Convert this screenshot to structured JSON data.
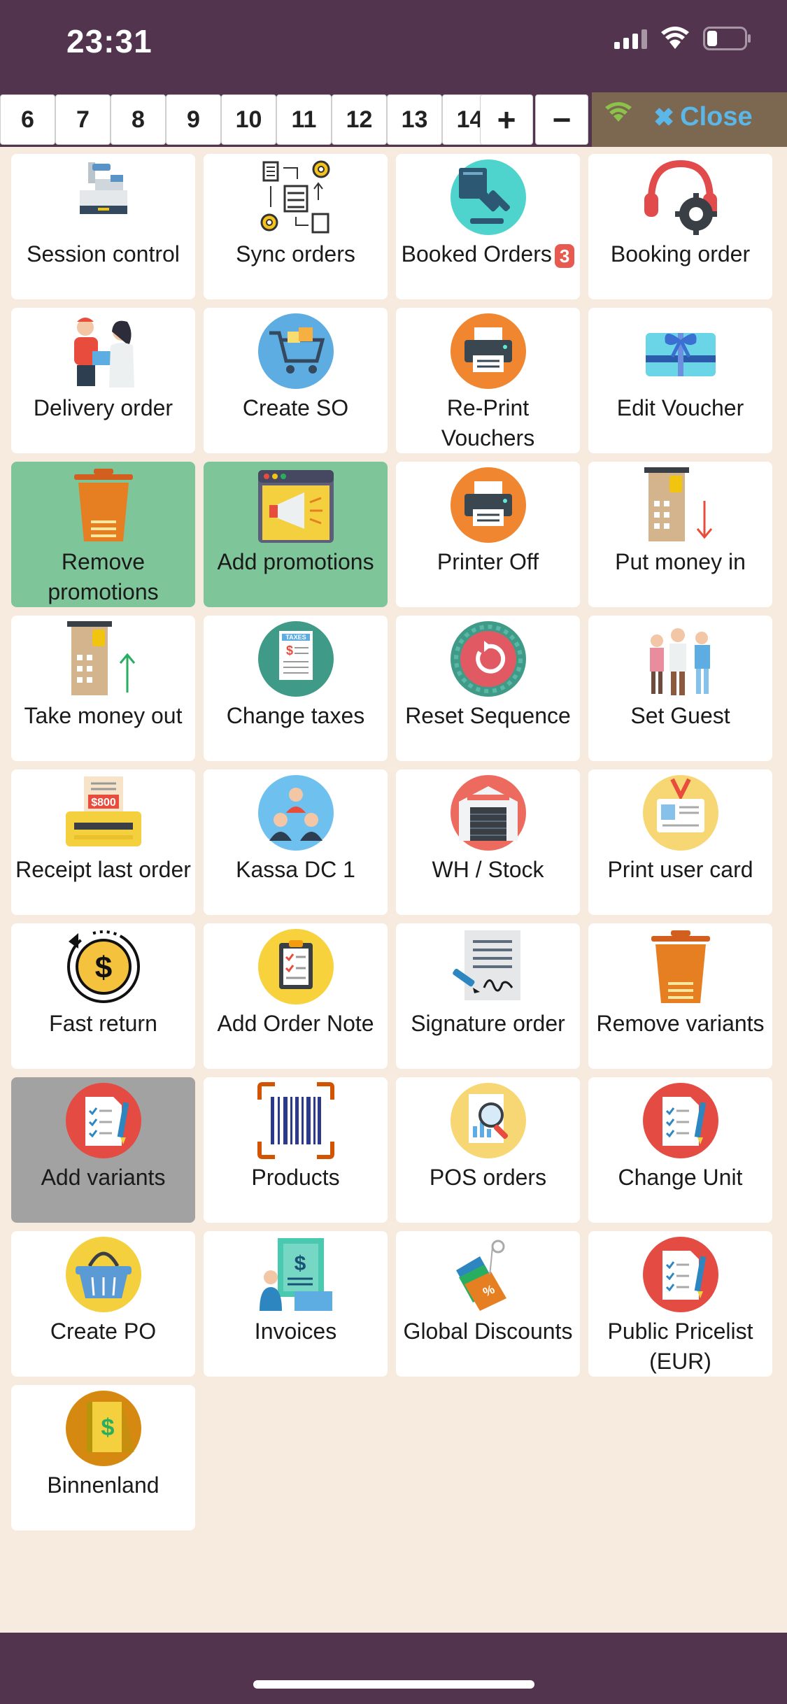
{
  "status": {
    "time": "23:31"
  },
  "toolbar": {
    "numbers": [
      "6",
      "7",
      "8",
      "9",
      "10",
      "11",
      "12",
      "13",
      "14"
    ],
    "plus": "+",
    "minus": "−",
    "close_label": "Close"
  },
  "tiles": [
    {
      "label": "Session control",
      "icon": "cash-register-icon"
    },
    {
      "label": "Sync orders",
      "icon": "sync-workflow-icon"
    },
    {
      "label": "Booked Orders",
      "badge": "3",
      "icon": "book-gavel-icon"
    },
    {
      "label": "Booking order",
      "icon": "headset-gear-icon"
    },
    {
      "label": "Delivery order",
      "icon": "delivery-person-icon"
    },
    {
      "label": "Create SO",
      "icon": "shopping-cart-icon"
    },
    {
      "label": "Re-Print Vouchers",
      "icon": "printer-icon"
    },
    {
      "label": "Edit Voucher",
      "icon": "gift-card-icon"
    },
    {
      "label": "Remove promotions",
      "icon": "trash-bin-icon",
      "state": "active"
    },
    {
      "label": "Add promotions",
      "icon": "megaphone-window-icon",
      "state": "active"
    },
    {
      "label": "Printer Off",
      "icon": "printer-icon"
    },
    {
      "label": "Put money in",
      "icon": "money-in-icon"
    },
    {
      "label": "Take money out",
      "icon": "money-out-icon"
    },
    {
      "label": "Change taxes",
      "icon": "taxes-document-icon"
    },
    {
      "label": "Reset Sequence",
      "icon": "reset-icon"
    },
    {
      "label": "Set Guest",
      "icon": "guests-group-icon"
    },
    {
      "label": "Receipt last order",
      "icon": "receipt-printer-icon"
    },
    {
      "label": "Kassa DC 1",
      "icon": "cashiers-icon"
    },
    {
      "label": "WH / Stock",
      "icon": "warehouse-icon"
    },
    {
      "label": "Print user card",
      "icon": "id-badge-icon"
    },
    {
      "label": "Fast return",
      "icon": "dollar-return-icon"
    },
    {
      "label": "Add Order Note",
      "icon": "clipboard-note-icon"
    },
    {
      "label": "Signature order",
      "icon": "signature-document-icon"
    },
    {
      "label": "Remove variants",
      "icon": "trash-bin-icon"
    },
    {
      "label": "Add variants",
      "icon": "checklist-icon",
      "state": "selected"
    },
    {
      "label": "Products",
      "icon": "barcode-icon"
    },
    {
      "label": "POS orders",
      "icon": "report-search-icon"
    },
    {
      "label": "Change Unit",
      "icon": "checklist-icon"
    },
    {
      "label": "Create PO",
      "icon": "shopping-basket-icon"
    },
    {
      "label": "Invoices",
      "icon": "invoice-person-icon"
    },
    {
      "label": "Global Discounts",
      "icon": "discount-tags-icon"
    },
    {
      "label": "Public Pricelist (EUR)",
      "icon": "checklist-icon"
    },
    {
      "label": "Binnenland",
      "icon": "pricebook-icon"
    }
  ],
  "colors": {
    "header_bg": "#52344e",
    "page_bg": "#f7ebe0",
    "active_tile": "#7ec699",
    "selected_tile": "#a2a2a2",
    "close_text": "#5ab7e8",
    "badge": "#e85a4f"
  }
}
